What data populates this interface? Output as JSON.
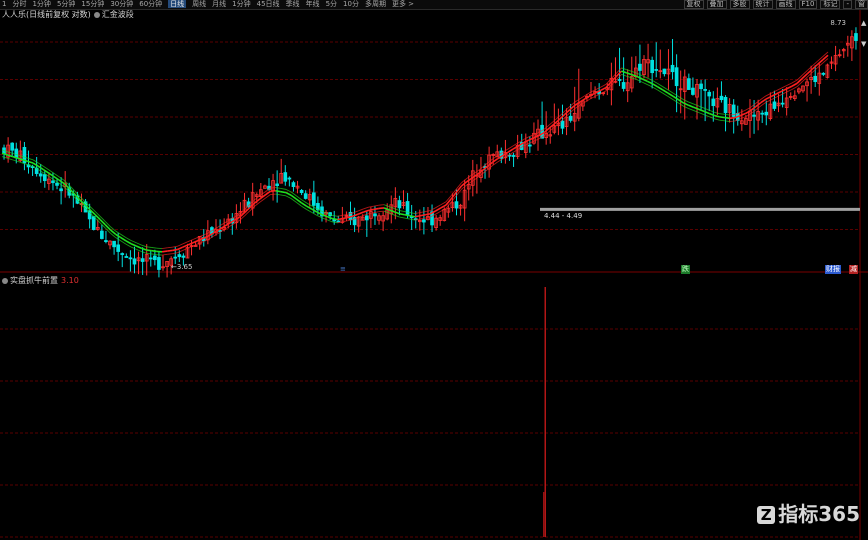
{
  "toolbar": {
    "periods": [
      {
        "label": "1"
      },
      {
        "label": "分时"
      },
      {
        "label": "1分钟"
      },
      {
        "label": "5分钟"
      },
      {
        "label": "15分钟"
      },
      {
        "label": "30分钟"
      },
      {
        "label": "60分钟"
      },
      {
        "label": "日线",
        "active": true
      },
      {
        "label": "周线"
      },
      {
        "label": "月线"
      },
      {
        "label": "1分钟"
      },
      {
        "label": "45日线"
      },
      {
        "label": "季线"
      },
      {
        "label": "年线"
      },
      {
        "label": "5分"
      },
      {
        "label": "10分"
      },
      {
        "label": "多周期"
      },
      {
        "label": "更多 >"
      }
    ],
    "right_buttons": [
      "复权",
      "叠加",
      "多股",
      "统计",
      "画线",
      "F10",
      "标记",
      "-",
      "窗"
    ]
  },
  "main_panel": {
    "indicator_name": "人人乐(日线前复权 对数)",
    "overlay_name": "汇金波段",
    "price_top_label": "8.73",
    "low_label": "←3.65",
    "range_label": "4.44 - 4.49",
    "signal_tags": [
      {
        "text": "≡"
      },
      {
        "text": "跌"
      },
      {
        "text": "财报"
      },
      {
        "text": "减"
      }
    ],
    "scroll_up": "▲",
    "scroll_down": "▼"
  },
  "sub_panel": {
    "indicator_name": "实盘抓牛前置",
    "value": "3.10"
  },
  "watermark": {
    "logo": "Z",
    "text": "指标365"
  },
  "colors": {
    "background": "#000000",
    "up": "#ff3030",
    "down": "#00e0e0",
    "ma_up": "#ff2020",
    "ma_down": "#20e020",
    "grid": "#5a0000",
    "range_bar": "#a0a0a0",
    "signal_line": "#c01818"
  },
  "chart_data": {
    "type": "line",
    "title": "人人乐(日线前复权 对数)",
    "y_scale": "log",
    "ylim": [
      3.6,
      9.2
    ],
    "annotations": [
      {
        "text": "←3.65",
        "y": 3.65
      },
      {
        "text": "4.44 - 4.49",
        "y": 4.47
      },
      {
        "text": "8.73",
        "y": 8.73
      }
    ],
    "close_path": [
      5.6,
      5.45,
      5.2,
      4.95,
      4.75,
      4.35,
      4.05,
      3.85,
      3.72,
      3.65,
      3.72,
      3.85,
      4.0,
      4.15,
      4.35,
      4.6,
      4.9,
      5.1,
      4.85,
      4.55,
      4.3,
      4.25,
      4.35,
      4.5,
      4.55,
      4.35,
      4.3,
      4.45,
      4.65,
      5.3,
      5.45,
      5.55,
      5.75,
      5.95,
      6.05,
      6.45,
      6.9,
      7.05,
      7.15,
      7.75,
      7.5,
      7.25,
      7.0,
      6.7,
      6.5,
      6.35,
      6.3,
      6.55,
      6.95,
      7.15,
      7.35,
      7.95,
      8.45
    ],
    "ma_band_path": [
      5.5,
      5.4,
      5.3,
      5.1,
      4.9,
      4.6,
      4.35,
      4.1,
      3.95,
      3.85,
      3.82,
      3.85,
      3.95,
      4.05,
      4.2,
      4.35,
      4.6,
      4.8,
      4.75,
      4.55,
      4.4,
      4.3,
      4.35,
      4.45,
      4.5,
      4.4,
      4.35,
      4.4,
      4.55,
      4.9,
      5.1,
      5.35,
      5.55,
      5.75,
      5.9,
      6.2,
      6.55,
      6.8,
      7.0,
      7.45,
      7.3,
      7.1,
      6.85,
      6.6,
      6.45,
      6.3,
      6.25,
      6.4,
      6.7,
      6.9,
      7.1,
      7.5,
      7.9
    ],
    "signal_series": {
      "name": "实盘抓牛前置",
      "value": 3.1,
      "spike_index": 33
    }
  }
}
